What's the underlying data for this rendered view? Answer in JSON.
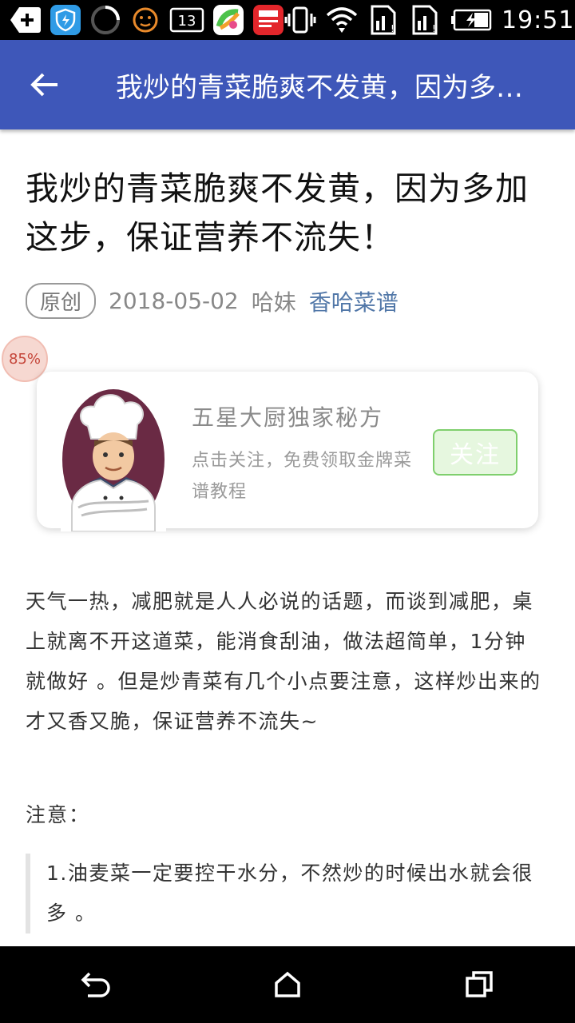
{
  "status_bar": {
    "time": "19:51",
    "notification_count": "13",
    "icons": [
      "add-icon",
      "shield-icon",
      "loading-ring-icon",
      "smiley-icon",
      "counter-badge-icon",
      "app-store-icon",
      "news-app-icon",
      "vibrate-icon",
      "wifi-icon",
      "sim1-signal-icon",
      "sim2-signal-icon",
      "battery-charging-icon"
    ]
  },
  "app_bar": {
    "title": "我炒的青菜脆爽不发黄，因为多加这步，保证营养不流失！",
    "color": "#3e57b9"
  },
  "article": {
    "title": "我炒的青菜脆爽不发黄，因为多加这步，保证营养不流失！",
    "badge": "原创",
    "date": "2018-05-02",
    "author": "哈妹",
    "source": "香哈菜谱",
    "read_progress": "85%"
  },
  "promo": {
    "heading": "五星大厨独家秘方",
    "description": "点击关注，免费领取金牌菜谱教程",
    "follow_label": "关注"
  },
  "body": {
    "intro": "天气一热，减肥就是人人必说的话题，而谈到减肥，桌上就离不开这道菜，能消食刮油，做法超简单，1分钟就做好 。但是炒青菜有几个小点要注意，这样炒出来的才又香又脆，保证营养不流失~",
    "note_label": "注意：",
    "quote": "1.油麦菜一定要控干水分，不然炒的时候出水就会很多 。"
  },
  "nav_bar": {
    "buttons": [
      "back-icon",
      "home-icon",
      "recents-icon"
    ]
  }
}
